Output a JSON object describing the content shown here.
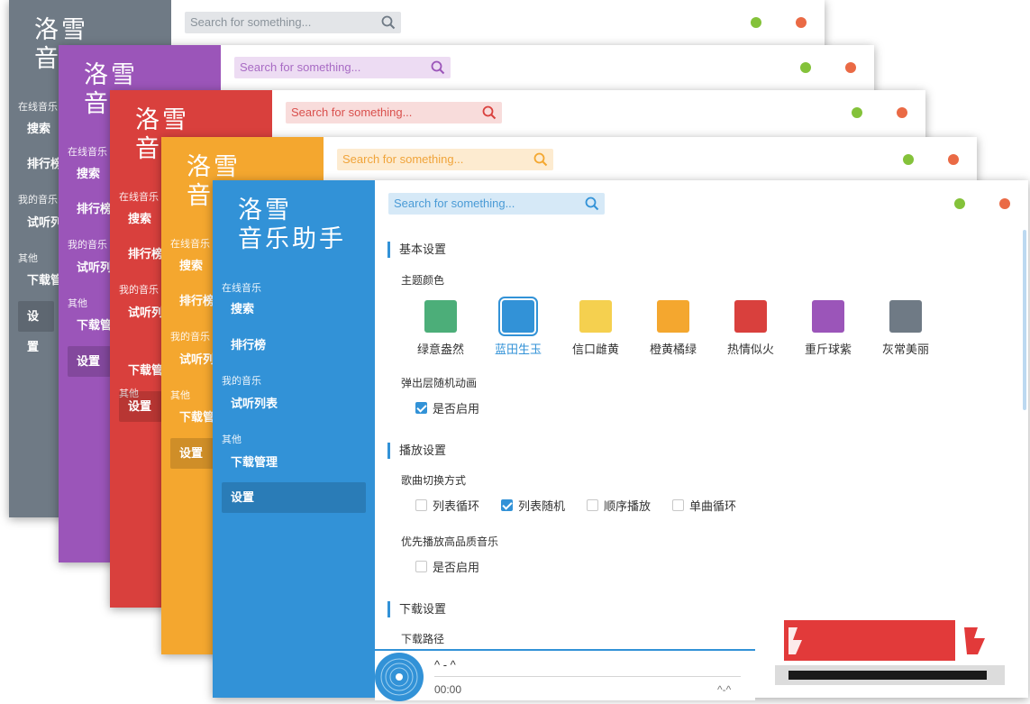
{
  "app": {
    "logo_line1": "洛雪",
    "logo_line2": "音乐助手",
    "logo_short": "音"
  },
  "search": {
    "placeholder": "Search for something..."
  },
  "sidebar": {
    "online_label": "在线音乐",
    "search_item": "搜索",
    "rank_item": "排行榜",
    "rank_short": "排行榜",
    "my_label": "我的音乐",
    "playlist_item": "试听列表",
    "playlist_short": "试听列",
    "other_label": "其他",
    "download_item": "下载管理",
    "download_short": "下载管",
    "settings_item": "设置"
  },
  "themes": {
    "gray": "#6f7a85",
    "purple": "#9b55b9",
    "red": "#d9403d",
    "orange": "#f4a72f",
    "blue": "#3292d7"
  },
  "settings": {
    "basic_title": "基本设置",
    "theme_label": "主题颜色",
    "theme_swatches": [
      {
        "name": "绿意盎然",
        "color": "#4cae79"
      },
      {
        "name": "蓝田生玉",
        "color": "#3292d7"
      },
      {
        "name": "信口雌黄",
        "color": "#f5d04f"
      },
      {
        "name": "橙黄橘绿",
        "color": "#f4a72f"
      },
      {
        "name": "热情似火",
        "color": "#d9403d"
      },
      {
        "name": "重斤球紫",
        "color": "#9b55b9"
      },
      {
        "name": "灰常美丽",
        "color": "#6f7a85"
      }
    ],
    "popup_label": "弹出层随机动画",
    "popup_enable": "是否启用",
    "play_title": "播放设置",
    "switch_label": "歌曲切换方式",
    "switch_options": [
      "列表循环",
      "列表随机",
      "顺序播放",
      "单曲循环"
    ],
    "quality_label": "优先播放高品质音乐",
    "quality_enable": "是否启用",
    "download_title": "下载设置",
    "download_path_label": "下载路径"
  },
  "player": {
    "title": "^ - ^",
    "time": "00:00",
    "right_text": "^-^"
  }
}
